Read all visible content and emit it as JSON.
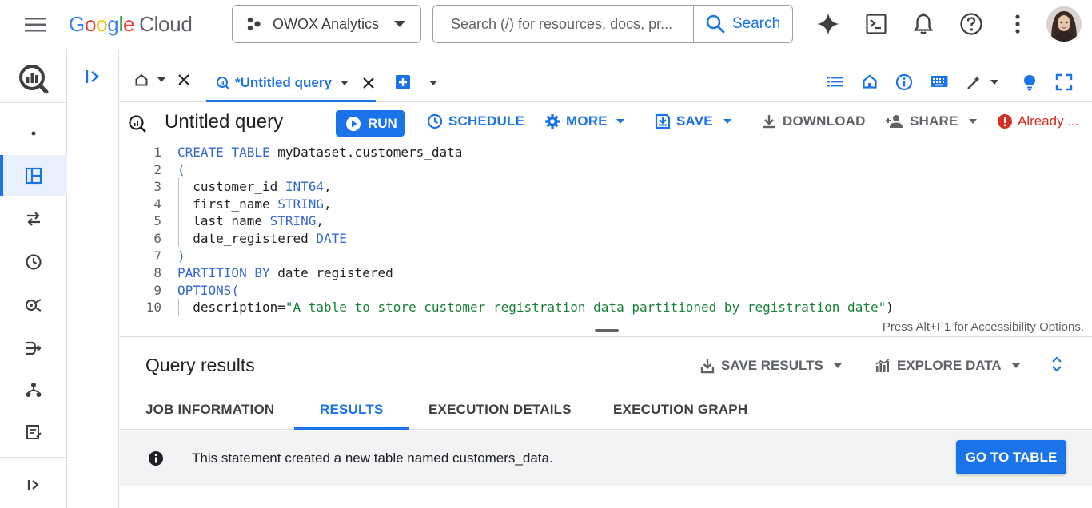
{
  "topbar": {
    "logo": {
      "g": "G",
      "o1": "o",
      "o2": "o",
      "g2": "g",
      "l": "l",
      "e": "e",
      "cloud": "Cloud"
    },
    "project": "OWOX Analytics",
    "search_placeholder": "Search (/) for resources, docs, pr...",
    "search_button": "Search"
  },
  "tabs": {
    "query_tab": "*Untitled query"
  },
  "editor_toolbar": {
    "title": "Untitled query",
    "run": "RUN",
    "schedule": "SCHEDULE",
    "more": "MORE",
    "save": "SAVE",
    "download": "DOWNLOAD",
    "share": "SHARE",
    "status": "Already ..."
  },
  "editor": {
    "lines": [
      {
        "n": "1"
      },
      {
        "n": "2"
      },
      {
        "n": "3"
      },
      {
        "n": "4"
      },
      {
        "n": "5"
      },
      {
        "n": "6"
      },
      {
        "n": "7"
      },
      {
        "n": "8"
      },
      {
        "n": "9"
      },
      {
        "n": "10"
      }
    ],
    "tokens": {
      "create_table": "CREATE TABLE",
      "table_name": " myDataset.customers_data",
      "open_paren": "(",
      "c1": "  customer_id ",
      "t1": "INT64",
      "p1": ",",
      "c2": "  first_name ",
      "t2": "STRING",
      "p2": ",",
      "c3": "  last_name ",
      "t3": "STRING",
      "p3": ",",
      "c4": "  date_registered ",
      "t4": "DATE",
      "close_paren": ")",
      "partition_by": "PARTITION BY",
      "partition_col": " date_registered",
      "options": "OPTIONS",
      "options_paren": "(",
      "desc_key": "  description=",
      "desc_val": "\"A table to store customer registration data partitioned by registration date\"",
      "desc_end": ")"
    },
    "accessibility": "Press Alt+F1 for Accessibility Options."
  },
  "results": {
    "title": "Query results",
    "save_results": "SAVE RESULTS",
    "explore_data": "EXPLORE DATA",
    "tabs": {
      "job_information": "JOB INFORMATION",
      "results": "RESULTS",
      "execution_details": "EXECUTION DETAILS",
      "execution_graph": "EXECUTION GRAPH"
    },
    "notice": "This statement created a new table named customers_data.",
    "go_to_table": "GO TO TABLE"
  },
  "colors": {
    "accent": "#1a73e8",
    "error": "#d93025",
    "keyword": "#3367d6",
    "string": "#188038"
  }
}
